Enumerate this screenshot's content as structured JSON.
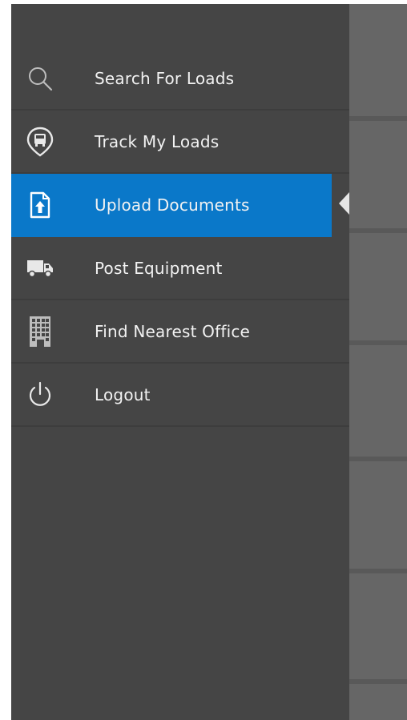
{
  "drawer": {
    "items": [
      {
        "label": "Search For Loads",
        "icon": "search-icon"
      },
      {
        "label": "Track My Loads",
        "icon": "truck-location-pin-icon"
      },
      {
        "label": "Upload Documents",
        "icon": "upload-document-icon",
        "active": true
      },
      {
        "label": "Post Equipment",
        "icon": "truck-icon"
      },
      {
        "label": "Find Nearest Office",
        "icon": "office-building-icon"
      },
      {
        "label": "Logout",
        "icon": "power-icon"
      }
    ]
  },
  "colors": {
    "drawer_bg": "#454545",
    "active_bg": "#0a78c9",
    "text": "#f2f2f2",
    "scrim": "#666666"
  }
}
